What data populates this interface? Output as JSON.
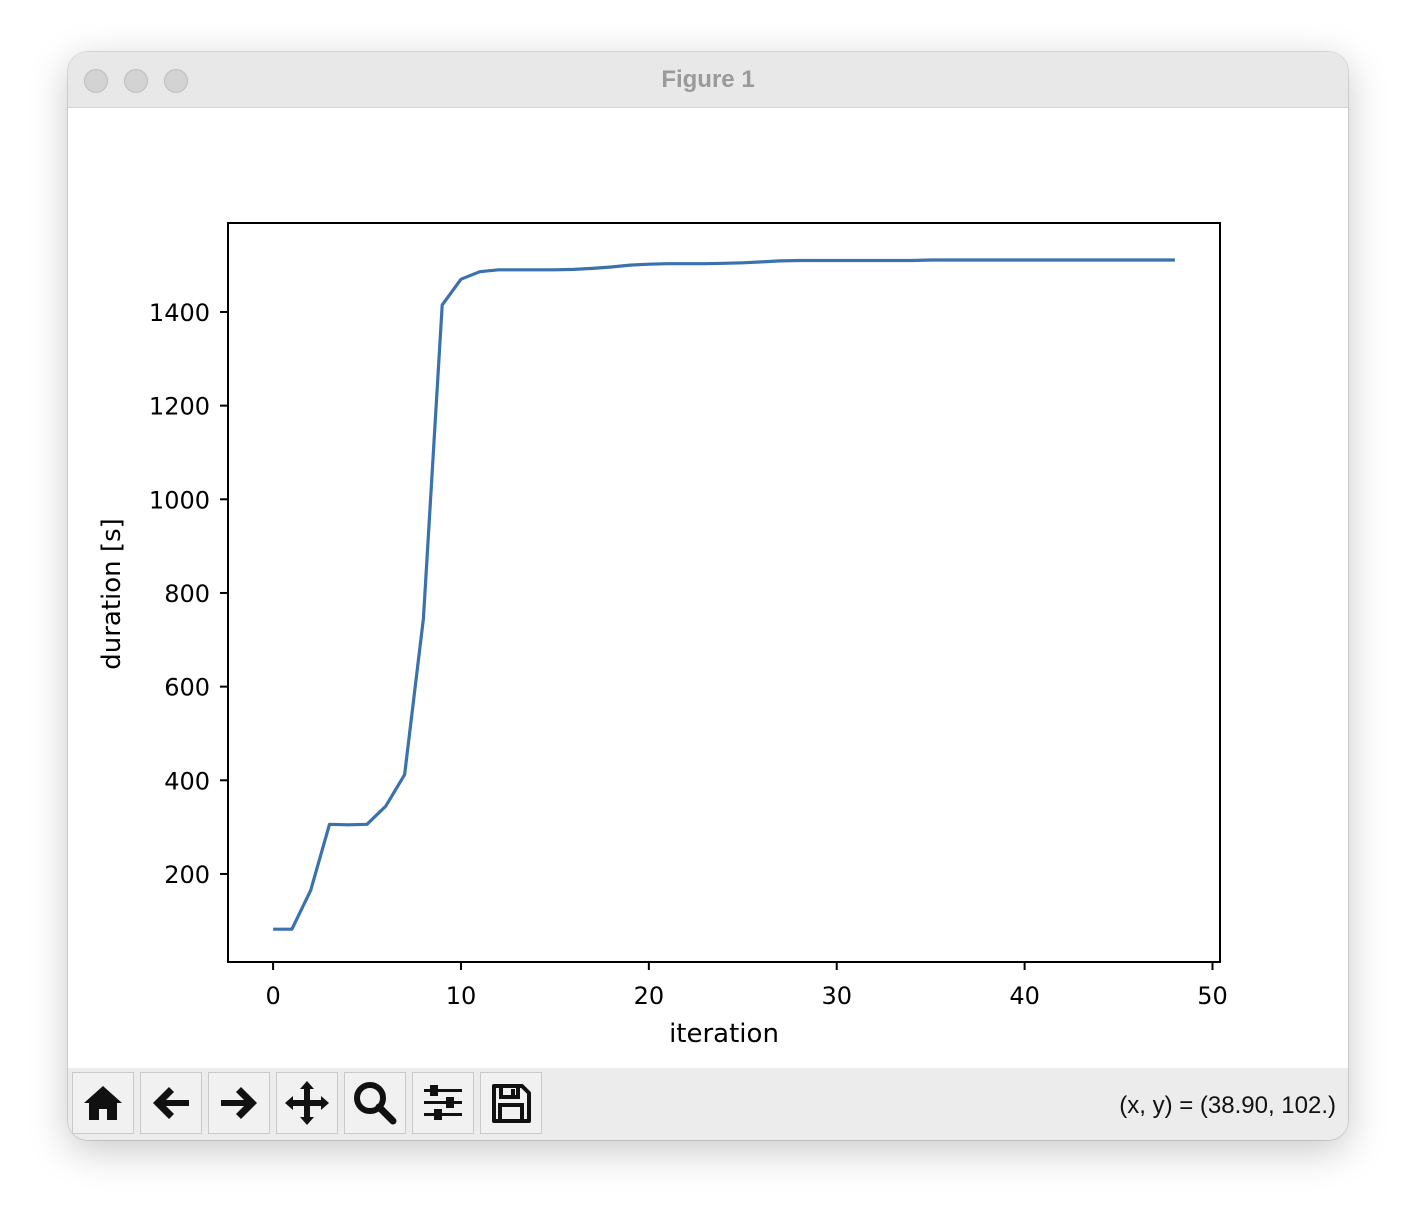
{
  "window": {
    "title": "Figure 1"
  },
  "toolbar": {
    "buttons": [
      {
        "name": "home-button",
        "icon": "home-icon"
      },
      {
        "name": "back-button",
        "icon": "arrow-left-icon"
      },
      {
        "name": "forward-button",
        "icon": "arrow-right-icon"
      },
      {
        "name": "pan-button",
        "icon": "move-icon"
      },
      {
        "name": "zoom-button",
        "icon": "magnifier-icon"
      },
      {
        "name": "configure-subplots-button",
        "icon": "sliders-icon"
      },
      {
        "name": "save-button",
        "icon": "floppy-disk-icon"
      }
    ],
    "coordinates": "(x, y) = (38.90, 102.)"
  },
  "chart_data": {
    "type": "line",
    "xlabel": "iteration",
    "ylabel": "duration [s]",
    "xlim": [
      -2.4,
      50.4
    ],
    "ylim": [
      12,
      1590
    ],
    "xticks": [
      0,
      10,
      20,
      30,
      40,
      50
    ],
    "yticks": [
      200,
      400,
      600,
      800,
      1000,
      1200,
      1400
    ],
    "grid": false,
    "color": "#3a72ad",
    "series": [
      {
        "x": [
          0,
          1,
          2,
          3,
          4,
          5,
          6,
          7,
          8,
          9,
          10,
          11,
          12,
          13,
          14,
          15,
          16,
          17,
          18,
          19,
          20,
          21,
          22,
          23,
          24,
          25,
          26,
          27,
          28,
          29,
          30,
          31,
          32,
          33,
          34,
          35,
          36,
          37,
          38,
          39,
          40,
          41,
          42,
          43,
          44,
          45,
          46,
          47,
          48
        ],
        "values": [
          82,
          82,
          165,
          306,
          305,
          306,
          345,
          412,
          745,
          1415,
          1470,
          1486,
          1490,
          1490,
          1490,
          1490,
          1491,
          1493,
          1496,
          1500,
          1502,
          1503,
          1503,
          1503,
          1504,
          1505,
          1507,
          1509,
          1510,
          1510,
          1510,
          1510,
          1510,
          1510,
          1510,
          1511,
          1511,
          1511,
          1511,
          1511,
          1511,
          1511,
          1511,
          1511,
          1511,
          1511,
          1511,
          1511,
          1511
        ]
      }
    ]
  }
}
